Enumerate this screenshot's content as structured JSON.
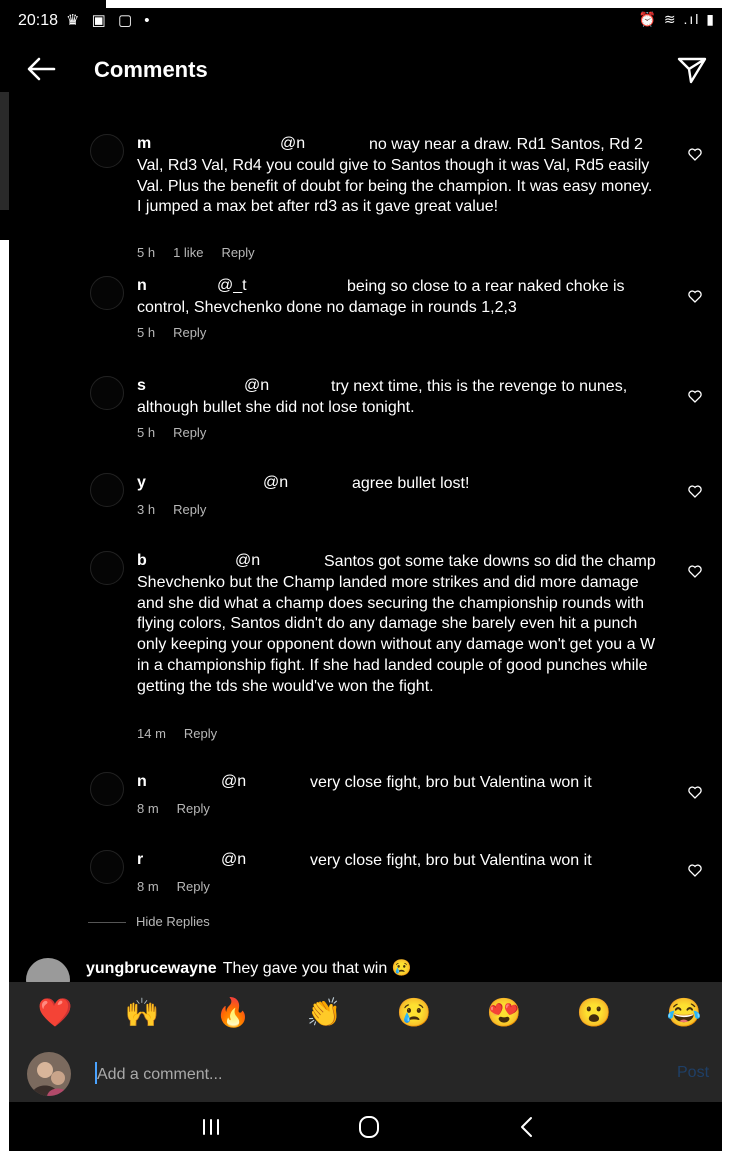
{
  "status_bar": {
    "time": "20:18",
    "left_icons": "♛ ▣ ▢ •",
    "right_icons": "⏰ ≋ .ıl ▮"
  },
  "header": {
    "title": "Comments"
  },
  "replies": [
    {
      "user": "m",
      "mention": "@n",
      "text": "no way near a draw. Rd1 Santos, Rd 2 Val, Rd3 Val, Rd4 you could give to Santos though it was Val, Rd5 easily Val. Plus the benefit of doubt for being the champion. It was easy money. I jumped a max bet after rd3 as it gave great value!",
      "time": "5 h",
      "likes": "1 like",
      "reply": "Reply"
    },
    {
      "user": "n",
      "mention": "@_t",
      "text": "being so close to a rear naked choke is control, Shevchenko done no damage in rounds 1,2,3",
      "time": "5 h",
      "likes": "",
      "reply": "Reply"
    },
    {
      "user": "s",
      "mention": "@n",
      "text": "try next time, this is the revenge to nunes, although bullet she did not lose tonight.",
      "time": "5 h",
      "likes": "",
      "reply": "Reply"
    },
    {
      "user": "y",
      "mention": "@n",
      "text": "agree bullet lost!",
      "time": "3 h",
      "likes": "",
      "reply": "Reply"
    },
    {
      "user": "b",
      "mention": "@n",
      "text": "Santos got some take downs so did the champ Shevchenko but the Champ landed more strikes and did more damage and she did what a champ does securing the championship rounds with flying colors, Santos didn't do any damage she barely even hit a punch only keeping your opponent down without any damage won't get you a W in a championship fight. If she had landed couple of good punches while getting the tds she would've won the fight.",
      "time": "14 m",
      "likes": "",
      "reply": "Reply"
    },
    {
      "user": "n",
      "mention": "@n",
      "text": "very close fight, bro but Valentina won it",
      "time": "8 m",
      "likes": "",
      "reply": "Reply"
    },
    {
      "user": "r",
      "mention": "@n",
      "text": "very close fight, bro but Valentina won it",
      "time": "8 m",
      "likes": "",
      "reply": "Reply"
    }
  ],
  "hide_replies": "Hide Replies",
  "root_comment": {
    "user": "yungbrucewayne",
    "text": "They gave you that win 😢"
  },
  "emoji_bar": [
    "❤️",
    "🙌",
    "🔥",
    "👏",
    "😢",
    "😍",
    "😮",
    "😂"
  ],
  "comment_box": {
    "placeholder": "Add a comment...",
    "post": "Post"
  },
  "colors": {
    "background": "#000000",
    "input_bar": "#262626",
    "meta_text": "#b8b8b8",
    "post_disabled": "#1f3f66"
  }
}
